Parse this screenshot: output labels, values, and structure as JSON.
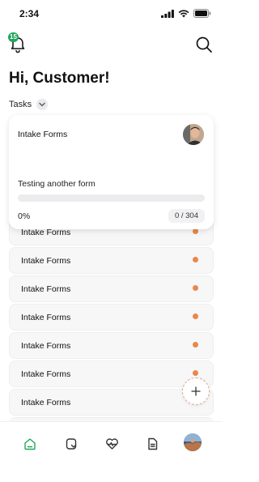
{
  "status_bar": {
    "time": "2:34",
    "icons": [
      "cellular-signal-icon",
      "wifi-icon",
      "battery-icon"
    ]
  },
  "header": {
    "notification_count": "15",
    "icons": [
      "bell-icon",
      "search-icon"
    ]
  },
  "greeting": "Hi, Customer!",
  "tasks": {
    "label": "Tasks",
    "chevron_icon": "chevron-down-icon"
  },
  "task_card": {
    "title": "Intake Forms",
    "subtitle": "Testing another form",
    "progress_percent_label": "0%",
    "progress_fraction": 0,
    "progress_count": "0 / 304",
    "progress_color": "#22a55b"
  },
  "task_list": [
    {
      "label": "Intake Forms"
    },
    {
      "label": "Intake Forms"
    },
    {
      "label": "Intake Forms"
    },
    {
      "label": "Intake Forms"
    },
    {
      "label": "Intake Forms"
    },
    {
      "label": "Intake Forms"
    },
    {
      "label": "Intake Forms"
    },
    {
      "label": "Intake Forms"
    }
  ],
  "colors": {
    "accent_green": "#22a55b",
    "status_dot_orange": "#e8884a"
  },
  "bottom_nav": [
    {
      "icon": "home-icon",
      "active": true
    },
    {
      "icon": "tag-icon",
      "active": false
    },
    {
      "icon": "heart-pulse-icon",
      "active": false
    },
    {
      "icon": "document-icon",
      "active": false
    },
    {
      "icon": "profile-avatar",
      "active": false
    }
  ],
  "fab_icon": "plus-icon"
}
